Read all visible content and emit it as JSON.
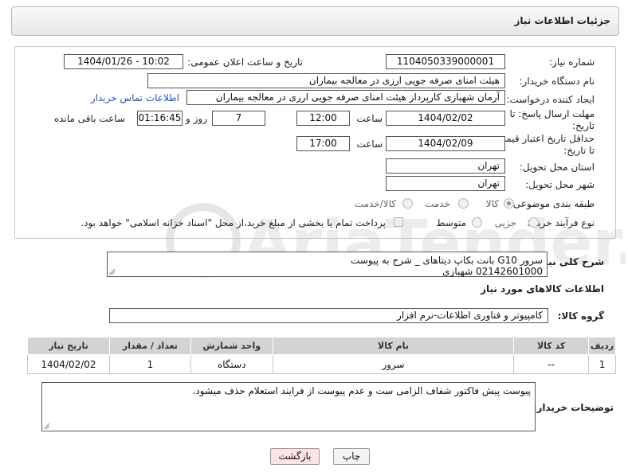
{
  "header": {
    "title": "جزئیات اطلاعات نیاز"
  },
  "form": {
    "need_number_label": "شماره نیاز:",
    "need_number": "1104050339000001",
    "announce_label": "تاریخ و ساعت اعلان عمومی:",
    "announce_value": "1404/01/26 - 10:02",
    "buyer_org_label": "نام دستگاه خریدار:",
    "buyer_org": "هیئت امنای صرفه جویی ارزی در معالجه بیماران",
    "creator_label": "ایجاد کننده درخواست:",
    "creator": "آرمان شهبازی کارپرداز هیئت امنای صرفه جویی ارزی در معالجه بیماران",
    "contact_link": "اطلاعات تماس خریدار",
    "deadline_label_1": "مهلت ارسال پاسخ: تا",
    "deadline_label_2": "تاریخ:",
    "deadline_date": "1404/02/02",
    "time_label": "ساعت",
    "deadline_time": "12:00",
    "days_value": "7",
    "days_label": "روز و",
    "remaining_value": "01:16:45",
    "remaining_label": "ساعت باقی مانده",
    "validity_label_1": "حداقل تاریخ اعتبار قیمت:",
    "validity_label_2": "تا تاریخ:",
    "validity_date": "1404/02/09",
    "validity_time_label": "ساعت",
    "validity_time": "17:00",
    "province_label": "استان محل تحویل:",
    "province": "تهران",
    "city_label": "شهر محل تحویل:",
    "city": "تهران",
    "category_label": "طبقه بندی موضوعی:",
    "category_options": [
      "کالا",
      "خدمت",
      "کالا/خدمت"
    ],
    "category_selected": "کالا",
    "process_label": "نوع فرآیند خرید :",
    "process_options": [
      "جزیی",
      "متوسط"
    ],
    "payment_note": "پرداخت تمام یا بخشی از مبلغ خرید،از محل \"اسناد خزانه اسلامی\" خواهد بود."
  },
  "summary": {
    "label": "شرح کلی نیاز:",
    "line1": "سرور G10 بانت بکاپ دیتاهای _ شرح به پیوست",
    "line2": "02142601000 شهبازی"
  },
  "goods_info_title": "اطلاعات کالاهای مورد نیاز",
  "goods_group": {
    "label": "گروه کالا:",
    "value": "کامپیوتر و فناوری اطلاعات-نرم افزار"
  },
  "table": {
    "headers": [
      "ردیف",
      "کد کالا",
      "نام کالا",
      "واحد شمارش",
      "تعداد / مقدار",
      "تاریخ نیاز"
    ],
    "rows": [
      [
        "1",
        "--",
        "سرور",
        "دستگاه",
        "1",
        "1404/02/02"
      ]
    ]
  },
  "buyer_notes": {
    "label": "توضیحات خریدار:",
    "text": "پیوست پیش فاکتور شفاف الزامی ست و عدم پیوست از فرایند استعلام حذف میشود."
  },
  "buttons": {
    "print": "چاپ",
    "back": "بازگشت"
  },
  "watermark": "AriaTender.neT",
  "colors": {
    "link": "#1a56c8",
    "back_button": "#fde3e3",
    "table_header": "#d3d3d3"
  }
}
